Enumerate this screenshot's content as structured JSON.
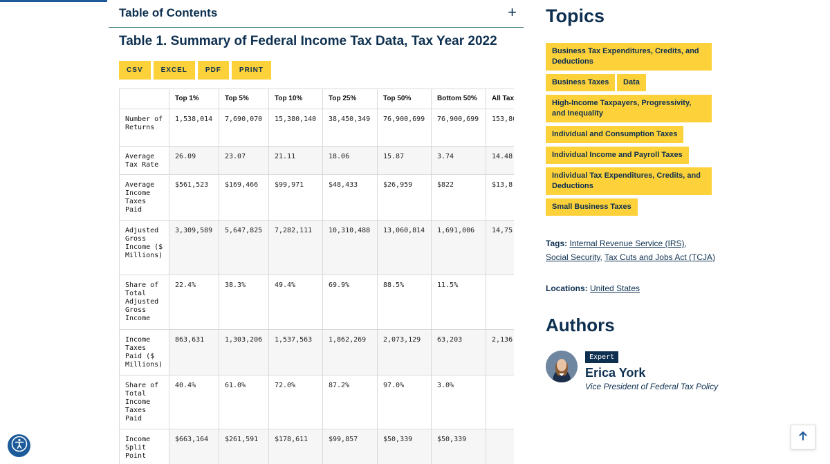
{
  "toc": {
    "title": "Table of Contents",
    "toggle_icon": "+"
  },
  "table_title": "Table 1. Summary of Federal Income Tax Data, Tax Year 2022",
  "export_buttons": [
    "CSV",
    "EXCEL",
    "PDF",
    "PRINT"
  ],
  "table": {
    "headers": [
      "",
      "Top 1%",
      "Top 5%",
      "Top 10%",
      "Top 25%",
      "Top 50%",
      "Bottom 50%",
      "All Tax"
    ],
    "rows": [
      {
        "label": "Number of Returns",
        "cells": [
          "1,538,014",
          "7,690,070",
          "15,380,140",
          "38,450,349",
          "76,900,699",
          "76,900,699",
          "153,80"
        ]
      },
      {
        "label": "Average Tax Rate",
        "cells": [
          "26.09",
          "23.07",
          "21.11",
          "18.06",
          "15.87",
          "3.74",
          "14.48"
        ]
      },
      {
        "label": "Average Income Taxes Paid",
        "cells": [
          "$561,523",
          "$169,466",
          "$99,971",
          "$48,433",
          "$26,959",
          "$822",
          "$13,8"
        ]
      },
      {
        "label": "Adjusted Gross Income ($ Millions)",
        "cells": [
          "3,309,589",
          "5,647,825",
          "7,282,111",
          "10,310,488",
          "13,060,814",
          "1,691,006",
          "14,75"
        ]
      },
      {
        "label": "Share of Total Adjusted Gross Income",
        "cells": [
          "22.4%",
          "38.3%",
          "49.4%",
          "69.9%",
          "88.5%",
          "11.5%",
          ""
        ]
      },
      {
        "label": "Income Taxes Paid ($ Millions)",
        "cells": [
          "863,631",
          "1,303,206",
          "1,537,563",
          "1,862,269",
          "2,073,129",
          "63,203",
          "2,136"
        ]
      },
      {
        "label": "Share of Total Income Taxes Paid",
        "cells": [
          "40.4%",
          "61.0%",
          "72.0%",
          "87.2%",
          "97.0%",
          "3.0%",
          ""
        ]
      },
      {
        "label": "Income Split Point",
        "cells": [
          "$663,164",
          "$261,591",
          "$178,611",
          "$99,857",
          "$50,339",
          "$50,339",
          ""
        ]
      }
    ]
  },
  "sidebar": {
    "topics_heading": "Topics",
    "topics": [
      "Business Tax Expenditures, Credits, and Deductions",
      "Business Taxes",
      "Data",
      "High-Income Taxpayers, Progressivity, and Inequality",
      "Individual and Consumption Taxes",
      "Individual Income and Payroll Taxes",
      "Individual Tax Expenditures, Credits, and Deductions",
      "Small Business Taxes"
    ],
    "tags_label": "Tags:",
    "tags": [
      "Internal Revenue Service (IRS)",
      "Social Security",
      "Tax Cuts and Jobs Act (TCJA)"
    ],
    "locations_label": "Locations:",
    "locations": [
      "United States"
    ],
    "authors_heading": "Authors",
    "author": {
      "badge": "Expert",
      "name": "Erica York",
      "role": "Vice President of Federal Tax Policy"
    }
  },
  "icons": {
    "accessibility": "accessibility-icon",
    "back_to_top": "arrow-up-icon"
  },
  "colors": {
    "navy": "#0e3050",
    "yellow": "#fdd13a",
    "blue": "#1d5a9a",
    "teal_rule": "#2a6f73"
  }
}
